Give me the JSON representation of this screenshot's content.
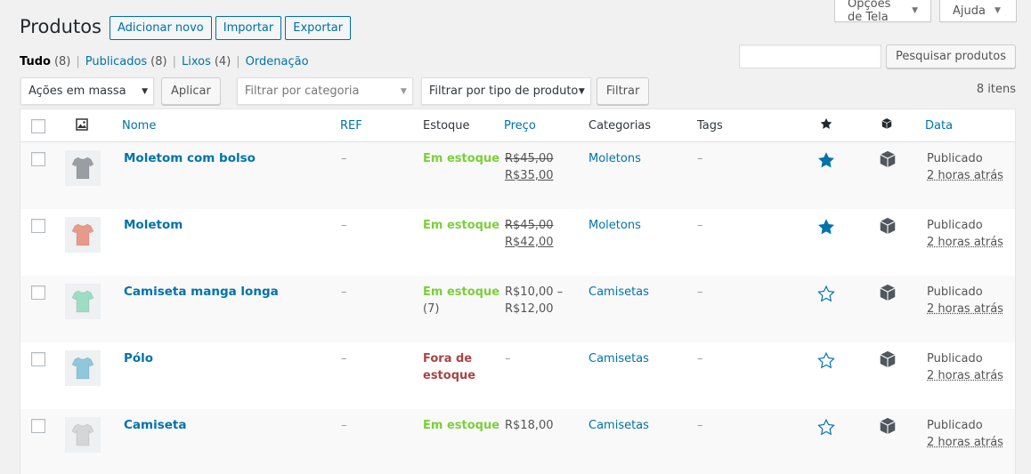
{
  "screen_meta": {
    "options_label": "Opções de Tela",
    "help_label": "Ajuda"
  },
  "header": {
    "title": "Produtos",
    "add_new": "Adicionar novo",
    "import": "Importar",
    "export": "Exportar"
  },
  "views": [
    {
      "label": "Tudo",
      "count": "(8)"
    },
    {
      "label": "Publicados",
      "count": "(8)"
    },
    {
      "label": "Lixos",
      "count": "(4)"
    },
    {
      "label": "Ordenação",
      "count": ""
    }
  ],
  "search": {
    "button": "Pesquisar produtos",
    "value": ""
  },
  "tablenav": {
    "bulk_actions": "Ações em massa",
    "apply": "Aplicar",
    "category_filter": "Filtrar por categoria",
    "type_filter": "Filtrar por tipo de produto",
    "filter": "Filtrar",
    "items_count": "8 itens"
  },
  "table": {
    "columns": {
      "name": "Nome",
      "sku": "REF",
      "stock": "Estoque",
      "price": "Preço",
      "categories": "Categorias",
      "tags": "Tags",
      "date": "Data"
    },
    "rows": [
      {
        "name": "Moletom com bolso",
        "sku": "–",
        "stock": "Em estoque",
        "stock_qty": "",
        "in_stock": true,
        "price_old": "R$45,00",
        "price_new": "R$35,00",
        "price_text": "",
        "price_text2": "",
        "category": "Moletons",
        "tags": "–",
        "featured": true,
        "status": "Publicado",
        "date": "2 horas atrás",
        "thumb_color": "#9a9ea3"
      },
      {
        "name": "Moletom",
        "sku": "–",
        "stock": "Em estoque",
        "stock_qty": "",
        "in_stock": true,
        "price_old": "R$45,00",
        "price_new": "R$42,00",
        "price_text": "",
        "price_text2": "",
        "category": "Moletons",
        "tags": "–",
        "featured": true,
        "status": "Publicado",
        "date": "2 horas atrás",
        "thumb_color": "#e9998a"
      },
      {
        "name": "Camiseta manga longa",
        "sku": "–",
        "stock": "Em estoque",
        "stock_qty": "(7)",
        "in_stock": true,
        "price_old": "",
        "price_new": "",
        "price_text": "R$10,00 –",
        "price_text2": "R$12,00",
        "category": "Camisetas",
        "tags": "–",
        "featured": false,
        "status": "Publicado",
        "date": "2 horas atrás",
        "thumb_color": "#9fdcc6"
      },
      {
        "name": "Pólo",
        "sku": "–",
        "stock": "Fora de",
        "stock2": "estoque",
        "stock_qty": "",
        "in_stock": false,
        "price_old": "",
        "price_new": "",
        "price_text": "–",
        "price_text2": "",
        "category": "Camisetas",
        "tags": "–",
        "featured": false,
        "status": "Publicado",
        "date": "2 horas atrás",
        "thumb_color": "#8fc7dd"
      },
      {
        "name": "Camiseta",
        "sku": "–",
        "stock": "Em estoque",
        "stock_qty": "",
        "in_stock": true,
        "price_old": "",
        "price_new": "",
        "price_text": "R$18,00",
        "price_text2": "",
        "category": "Camisetas",
        "tags": "–",
        "featured": false,
        "status": "Publicado",
        "date": "2 horas atrás",
        "thumb_color": "#d4d6d8"
      }
    ]
  },
  "icons": {
    "thumb_column": "image-icon",
    "featured_column": "star-icon",
    "type_column": "product-type-icon",
    "dropdown": "chevron-down-icon"
  },
  "colors": {
    "link": "#0073aa",
    "in_stock": "#7ad03a",
    "out_of_stock": "#aa4444",
    "featured_star": "#0073aa"
  }
}
